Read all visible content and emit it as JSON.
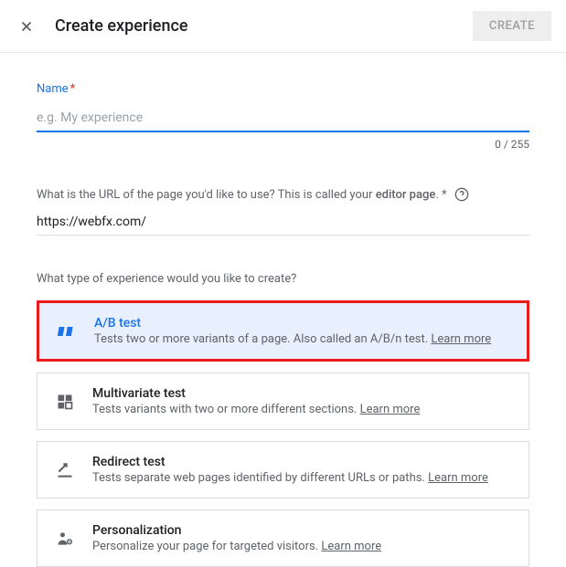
{
  "header": {
    "title": "Create experience",
    "create_btn": "CREATE"
  },
  "name": {
    "label": "Name",
    "placeholder": "e.g. My experience",
    "value": "",
    "char_count": "0 / 255"
  },
  "url": {
    "label_prefix": "What is the URL of the page you'd like to use? This is called your ",
    "label_bold": "editor page",
    "label_suffix": ". *",
    "value": "https://webfx.com/"
  },
  "type_section": {
    "label": "What type of experience would you like to create?",
    "options": [
      {
        "title": "A/B test",
        "desc": "Tests two or more variants of a page. Also called an A/B/n test.",
        "learn_more": "Learn more"
      },
      {
        "title": "Multivariate test",
        "desc": "Tests variants with two or more different sections.",
        "learn_more": "Learn more"
      },
      {
        "title": "Redirect test",
        "desc": "Tests separate web pages identified by different URLs or paths.",
        "learn_more": "Learn more"
      },
      {
        "title": "Personalization",
        "desc": "Personalize your page for targeted visitors.",
        "learn_more": "Learn more"
      }
    ]
  }
}
